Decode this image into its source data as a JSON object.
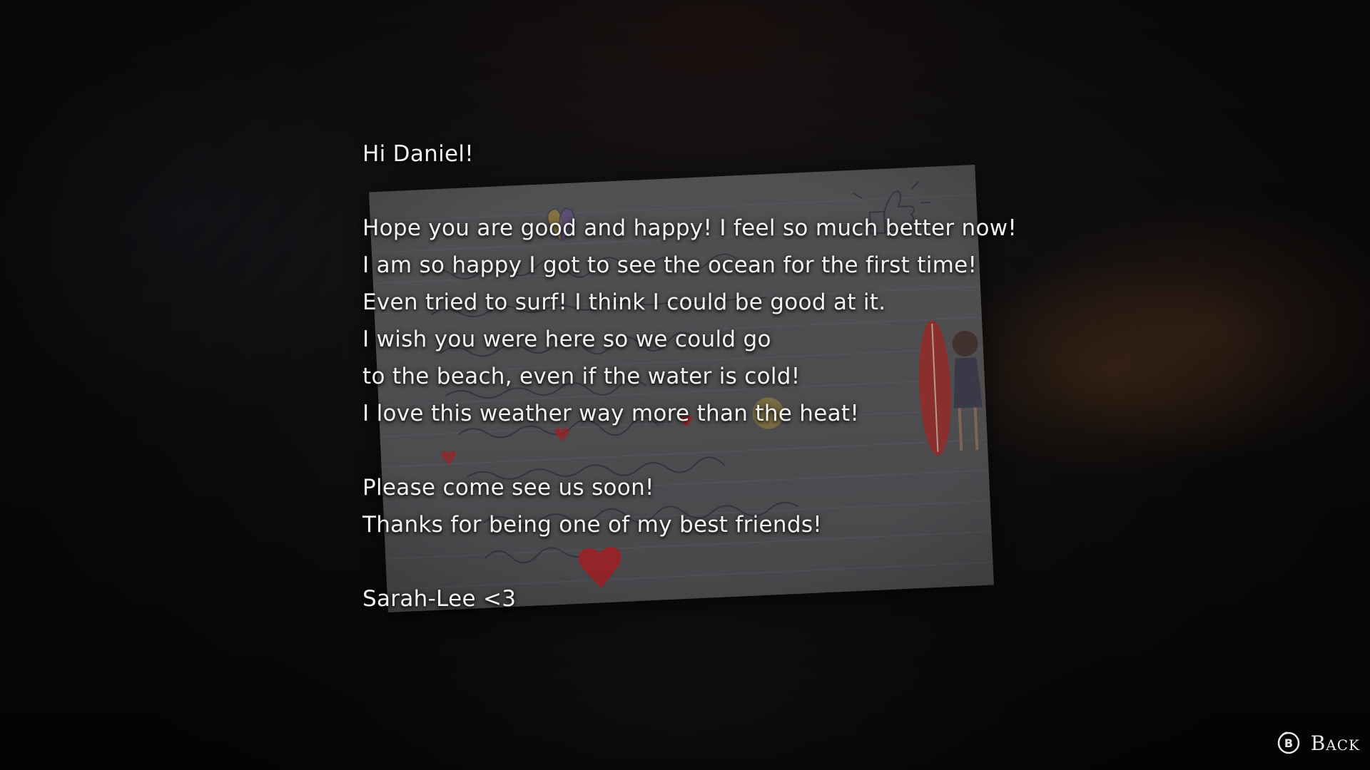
{
  "letter": {
    "greeting": "Hi Daniel!",
    "paragraph1": [
      "Hope you are good and happy! I feel so much better now!",
      "I am so happy I got to see the ocean for the first time!",
      "Even tried to surf! I think I could be good at it.",
      "I wish you were here so we could go",
      "to the beach, even if the water is cold!",
      "I love this weather way more than the heat!"
    ],
    "paragraph2": [
      "Please come see us soon!",
      "Thanks for being one of my best friends!"
    ],
    "signature": "Sarah-Lee <3"
  },
  "prompt": {
    "button_glyph": "B",
    "back_label": "Back"
  },
  "icons": {
    "back_button": "b-button-icon",
    "heart": "heart-icon",
    "surfboard": "surfboard-doodle",
    "butterfly": "butterfly-doodle",
    "thumbs_up": "thumbs-up-doodle"
  },
  "colors": {
    "text": "#f2f2f2",
    "background": "#0d0b0c",
    "note_paper": "#5c5b5e",
    "heart": "#b3262a",
    "surfboard": "#a8302f"
  }
}
